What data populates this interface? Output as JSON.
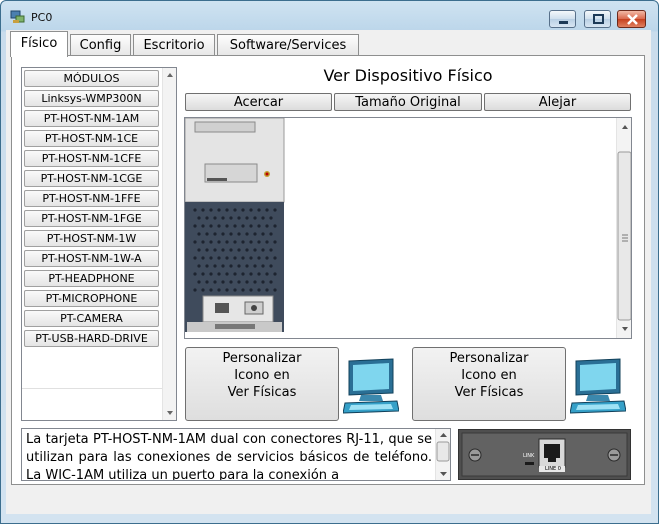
{
  "window": {
    "title": "PC0"
  },
  "tabs": [
    {
      "label": "Físico",
      "active": true
    },
    {
      "label": "Config",
      "active": false
    },
    {
      "label": "Escritorio",
      "active": false
    },
    {
      "label": "Software/Services",
      "active": false
    }
  ],
  "modules": {
    "items": [
      "MÓDULOS",
      "Linksys-WMP300N",
      "PT-HOST-NM-1AM",
      "PT-HOST-NM-1CE",
      "PT-HOST-NM-1CFE",
      "PT-HOST-NM-1CGE",
      "PT-HOST-NM-1FFE",
      "PT-HOST-NM-1FGE",
      "PT-HOST-NM-1W",
      "PT-HOST-NM-1W-A",
      "PT-HEADPHONE",
      "PT-MICROPHONE",
      "PT-CAMERA",
      "PT-USB-HARD-DRIVE"
    ]
  },
  "main": {
    "heading": "Ver Dispositivo Físico",
    "zoom_in": "Acercar",
    "original_size": "Tamaño Original",
    "zoom_out": "Alejar",
    "customize_left": [
      "Personalizar",
      "Icono en",
      "Ver Físicas"
    ],
    "customize_right": [
      "Personalizar",
      "Icono en",
      "Ver Físicas"
    ]
  },
  "description": "La tarjeta PT-HOST-NM-1AM dual con conectores RJ-11, que se utilizan para las conexiones de servicios básicos de teléfono. La WIC-1AM utiliza un puerto para la conexión a",
  "module_image": {
    "link_label": "LINK",
    "port_label": "LINE 0"
  },
  "icons": [
    "pc-app-icon",
    "minimize-icon",
    "maximize-icon",
    "close-icon",
    "computer-icon"
  ],
  "colors": {
    "title_bar": "#c9dcec",
    "close_button": "#c5401e",
    "panel_bg": "#ffffff"
  }
}
